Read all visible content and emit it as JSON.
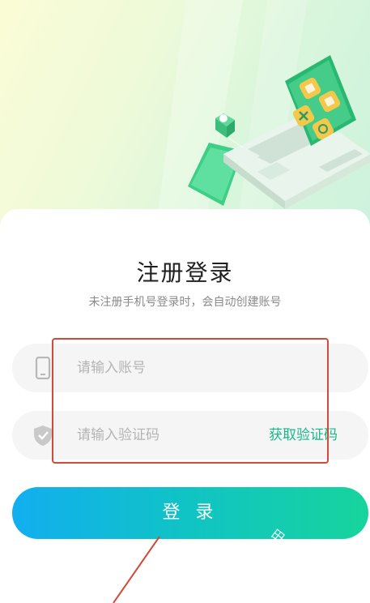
{
  "header": {
    "title": "注册登录",
    "subtitle": "未注册手机号登录时，会自动创建账号"
  },
  "form": {
    "phone_placeholder": "请输入账号",
    "code_placeholder": "请输入验证码",
    "get_code_label": "获取验证码"
  },
  "login_label": "登 录",
  "watermark": "田今",
  "icons": [
    "phone-icon",
    "shield-icon"
  ],
  "colors": {
    "accent_green": "#19b98a",
    "gradient_start": "#12aef0",
    "gradient_end": "#17d49c",
    "highlight_red": "#d24b3a"
  }
}
